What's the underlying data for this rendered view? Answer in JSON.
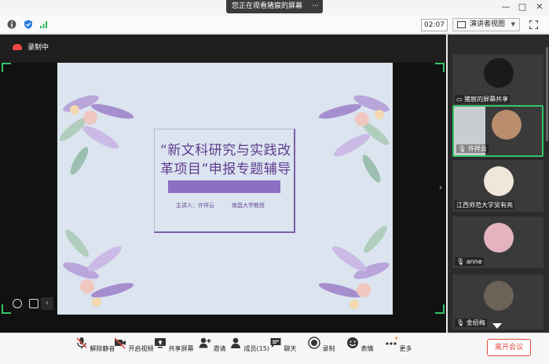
{
  "window": {
    "share_banner": "您正在观看猪宸的屏幕",
    "share_menu": "···",
    "controls": {
      "minimize": "—",
      "maximize": "□",
      "close": "✕"
    }
  },
  "infobar": {
    "timer": "02:07",
    "view_mode": "演讲者视图",
    "icons": [
      "info-icon",
      "shield-icon",
      "signal-icon",
      "fullscreen-icon"
    ]
  },
  "recording": {
    "label": "录制中"
  },
  "slide": {
    "title_line1": "“新文科研究与实践改",
    "title_line2": "革项目”申报专题辅导",
    "presenter": "主讲人：许祥云",
    "affiliation": "南昌大学教授"
  },
  "participants": [
    {
      "name": "猪宸的屏幕共享",
      "type": "screen-share",
      "active": false
    },
    {
      "name": "许祥云",
      "type": "video",
      "active": true
    },
    {
      "name": "江西师范大学吴有亮",
      "type": "avatar",
      "active": false
    },
    {
      "name": "anne",
      "type": "avatar",
      "active": false
    },
    {
      "name": "金绍梅",
      "type": "avatar",
      "active": false
    }
  ],
  "toolbar": {
    "unmute": "解除静音",
    "start_video": "开启视频",
    "share_screen": "共享屏幕",
    "invite": "邀请",
    "members": "成员(15)",
    "chat": "聊天",
    "record": "录制",
    "reactions": "表情",
    "more": "更多",
    "leave": "离开会议"
  },
  "colors": {
    "accent_green": "#35c46a",
    "leave_red": "#e04a3e",
    "slide_purple": "#5e3c8f"
  }
}
